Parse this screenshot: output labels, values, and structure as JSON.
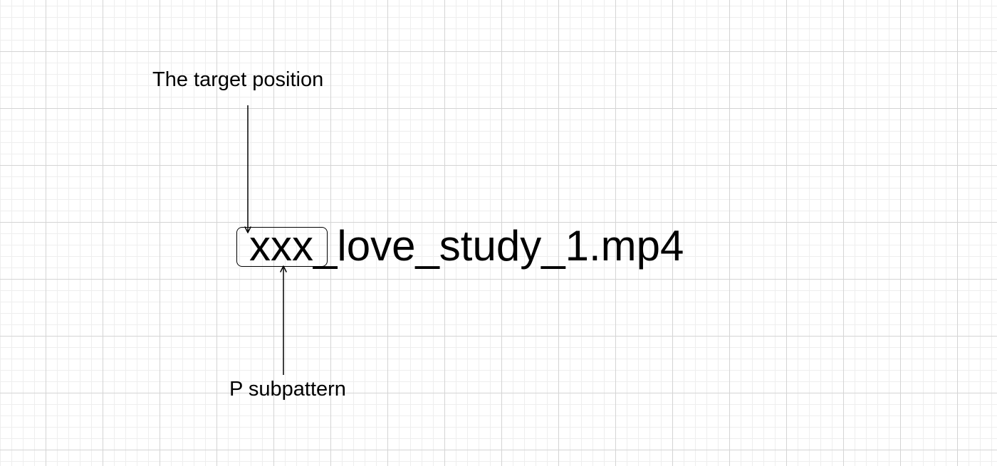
{
  "diagram": {
    "target_label": "The target position",
    "filename": {
      "highlighted": "xxx",
      "rest": "_love_study_1.mp4"
    },
    "subpattern_label": "P subpattern"
  },
  "colors": {
    "background": "#ffffff",
    "grid_major": "#d4d4d4",
    "grid_minor": "#eeeeee",
    "ink": "#000000"
  }
}
